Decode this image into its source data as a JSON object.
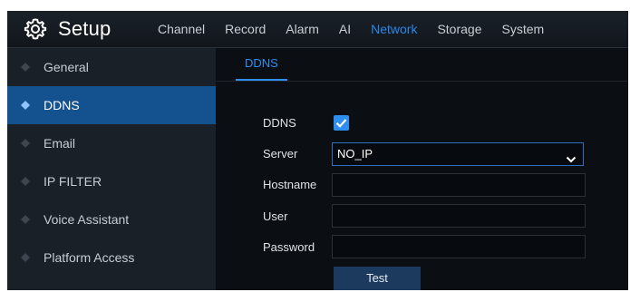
{
  "header": {
    "title": "Setup",
    "icon": "gear-icon",
    "tabs": [
      {
        "label": "Channel",
        "active": false
      },
      {
        "label": "Record",
        "active": false
      },
      {
        "label": "Alarm",
        "active": false
      },
      {
        "label": "AI",
        "active": false
      },
      {
        "label": "Network",
        "active": true
      },
      {
        "label": "Storage",
        "active": false
      },
      {
        "label": "System",
        "active": false
      }
    ]
  },
  "sidebar": {
    "items": [
      {
        "label": "General",
        "active": false
      },
      {
        "label": "DDNS",
        "active": true
      },
      {
        "label": "Email",
        "active": false
      },
      {
        "label": "IP FILTER",
        "active": false
      },
      {
        "label": "Voice Assistant",
        "active": false
      },
      {
        "label": "Platform Access",
        "active": false
      }
    ]
  },
  "content": {
    "subtab": "DDNS",
    "form": {
      "ddns_label": "DDNS",
      "ddns_enabled": true,
      "server_label": "Server",
      "server_value": "NO_IP",
      "hostname_label": "Hostname",
      "hostname_value": "",
      "user_label": "User",
      "user_value": "",
      "password_label": "Password",
      "password_value": "",
      "test_label": "Test"
    }
  },
  "colors": {
    "accent": "#2a86e8",
    "sidebar_active": "#13518f",
    "background": "#0b0f14"
  }
}
